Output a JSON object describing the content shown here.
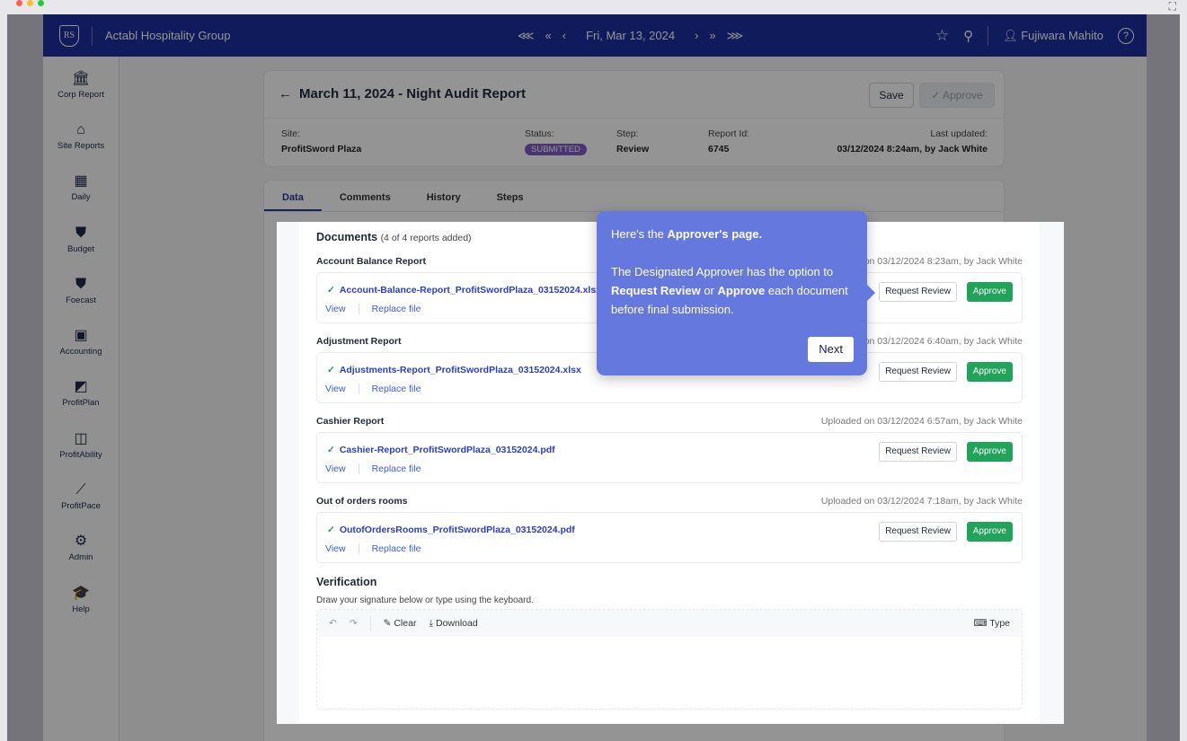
{
  "window": {
    "dots": [
      "#ff5f57",
      "#febc2e",
      "#28c840"
    ]
  },
  "header": {
    "logo": "RS",
    "org": "Actabl Hospitality Group",
    "nav_first": "⋘",
    "nav_prev_week": "«",
    "nav_prev": "‹",
    "date": "Fri, Mar 13, 2024",
    "nav_next": "›",
    "nav_next_week": "»",
    "nav_last": "⋙",
    "user": "Fujiwara Mahito"
  },
  "sidebar": {
    "items": [
      {
        "label": "Corp Report",
        "icon": "🏛"
      },
      {
        "label": "Site Reports",
        "icon": "⌂"
      },
      {
        "label": "Daily",
        "icon": "▦"
      },
      {
        "label": "Budget",
        "icon": "⛊"
      },
      {
        "label": "Foecast",
        "icon": "⛊"
      },
      {
        "label": "Accounting",
        "icon": "▣"
      },
      {
        "label": "ProfitPlan",
        "icon": "◩"
      },
      {
        "label": "ProfitAbility",
        "icon": "◫"
      },
      {
        "label": "ProfitPace",
        "icon": "⟋"
      },
      {
        "label": "Admin",
        "icon": "⚙"
      },
      {
        "label": "Help",
        "icon": "🎓"
      }
    ]
  },
  "report": {
    "title": "March 11, 2024 - Night Audit Report",
    "save": "Save",
    "approve": "✓ Approve",
    "site_label": "Site:",
    "site": "ProfitSword Plaza",
    "status_label": "Status:",
    "status": "SUBMITTED",
    "step_label": "Step:",
    "step": "Review",
    "id_label": "Report Id:",
    "id": "6745",
    "updated_label": "Last updated:",
    "updated": "03/12/2024 8:24am, by Jack White"
  },
  "tabs": [
    "Data",
    "Comments",
    "History",
    "Steps"
  ],
  "documents": {
    "heading": "Documents",
    "count": "(4 of 4 reports added)",
    "view": "View",
    "replace": "Replace file",
    "request_review": "Request Review",
    "approve": "Approve",
    "items": [
      {
        "label": "Account Balance Report",
        "uploaded": "Uploaded on 03/12/2024 8:23am, by Jack White",
        "file": "Account-Balance-Report_ProfitSwordPlaza_03152024.xlsx"
      },
      {
        "label": "Adjustment Report",
        "uploaded": "Uploaded on 03/12/2024 6:40am, by Jack White",
        "file": "Adjustments-Report_ProfitSwordPlaza_03152024.xlsx"
      },
      {
        "label": "Cashier Report",
        "uploaded": "Uploaded on 03/12/2024 6:57am, by Jack White",
        "file": "Cashier-Report_ProfitSwordPlaza_03152024.pdf"
      },
      {
        "label": "Out of orders rooms",
        "uploaded": "Uploaded on 03/12/2024 7:18am, by Jack White",
        "file": "OutofOrdersRooms_ProfitSwordPlaza_03152024.pdf"
      }
    ]
  },
  "verification": {
    "heading": "Verification",
    "desc": "Draw your signature below or type using the keyboard.",
    "clear": "Clear",
    "download": "Download",
    "type": "Type"
  },
  "tour": {
    "intro": "Here's the ",
    "intro_bold": "Approver's page.",
    "l1": "The Designated Approver has the option to ",
    "b1": "Request Review",
    "or": " or ",
    "b2": "Approve",
    "l2": " each document before final submission.",
    "next": "Next"
  }
}
